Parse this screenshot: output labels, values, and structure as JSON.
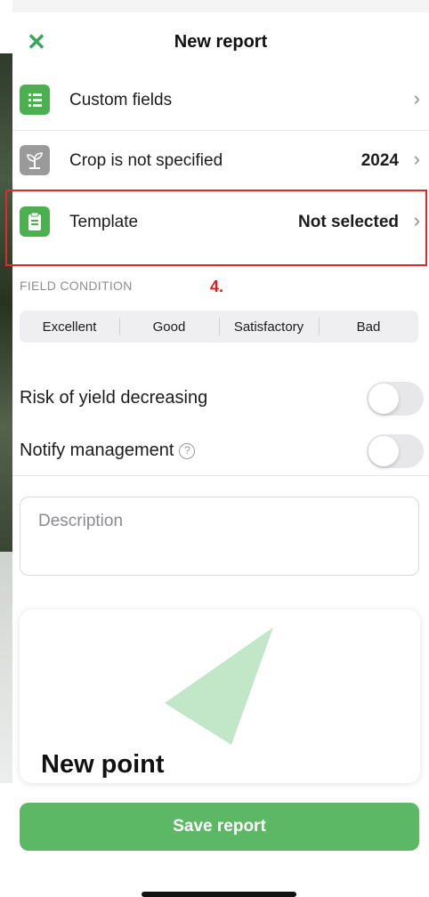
{
  "header": {
    "title": "New report",
    "close_icon": "close-icon"
  },
  "rows": [
    {
      "label": "Custom fields",
      "value": "",
      "icon": "list-icon"
    },
    {
      "label": "Crop is not specified",
      "value": "2024",
      "icon": "seedling-icon"
    },
    {
      "label": "Template",
      "value": "Not selected",
      "icon": "clipboard-icon"
    }
  ],
  "annotation": "4.",
  "field_condition": {
    "label": "FIELD CONDITION",
    "options": [
      "Excellent",
      "Good",
      "Satisfactory",
      "Bad"
    ]
  },
  "toggles": {
    "risk": {
      "label": "Risk of yield decreasing",
      "on": false
    },
    "notify": {
      "label": "Notify management",
      "help": "?",
      "on": false
    }
  },
  "description": {
    "placeholder": "Description",
    "value": ""
  },
  "card": {
    "title": "New point"
  },
  "save_button": "Save report",
  "colors": {
    "accent": "#4caf50",
    "button": "#5db866",
    "highlight": "#e02b2b"
  }
}
